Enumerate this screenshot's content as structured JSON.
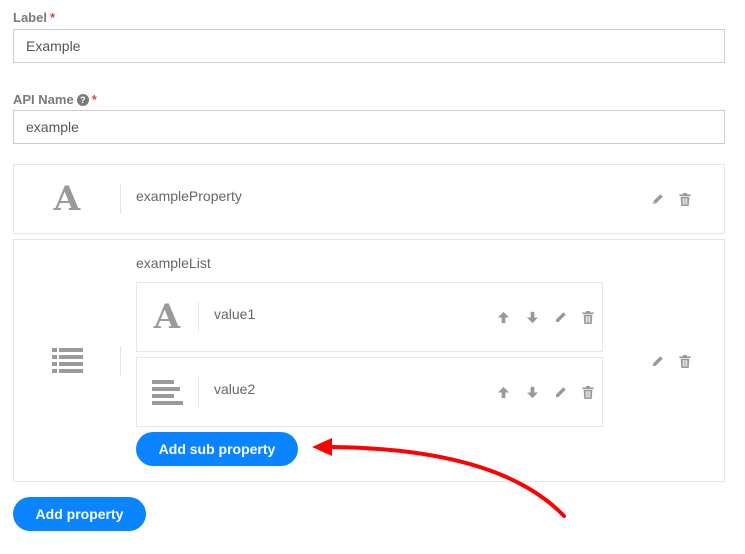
{
  "form": {
    "label_field": {
      "label": "Label",
      "required_marker": "*",
      "value": "Example"
    },
    "api_name_field": {
      "label": "API Name",
      "help_icon": "question-circle-icon",
      "help_glyph": "?",
      "required_marker": "*",
      "value": "example"
    }
  },
  "properties": [
    {
      "name": "exampleProperty",
      "type_icon": "text-type-icon",
      "type_glyph": "A",
      "actions": [
        "edit-icon",
        "trash-icon"
      ]
    },
    {
      "name": "exampleList",
      "type_icon": "list-type-icon",
      "actions": [
        "edit-icon",
        "trash-icon"
      ],
      "sub_properties": [
        {
          "name": "value1",
          "type_icon": "text-type-icon",
          "type_glyph": "A",
          "actions": [
            "arrow-up-icon",
            "arrow-down-icon",
            "edit-icon",
            "trash-icon"
          ]
        },
        {
          "name": "value2",
          "type_icon": "align-left-icon",
          "actions": [
            "arrow-up-icon",
            "arrow-down-icon",
            "edit-icon",
            "trash-icon"
          ]
        }
      ],
      "add_sub_property_label": "Add sub property"
    }
  ],
  "add_property_label": "Add property",
  "annotation": {
    "type": "arrow",
    "points_to": "add-sub-property-button",
    "color": "#ff0000"
  },
  "colors": {
    "accent": "#0a84ff",
    "required": "#e0443e",
    "icon_gray": "#9a9a98"
  }
}
